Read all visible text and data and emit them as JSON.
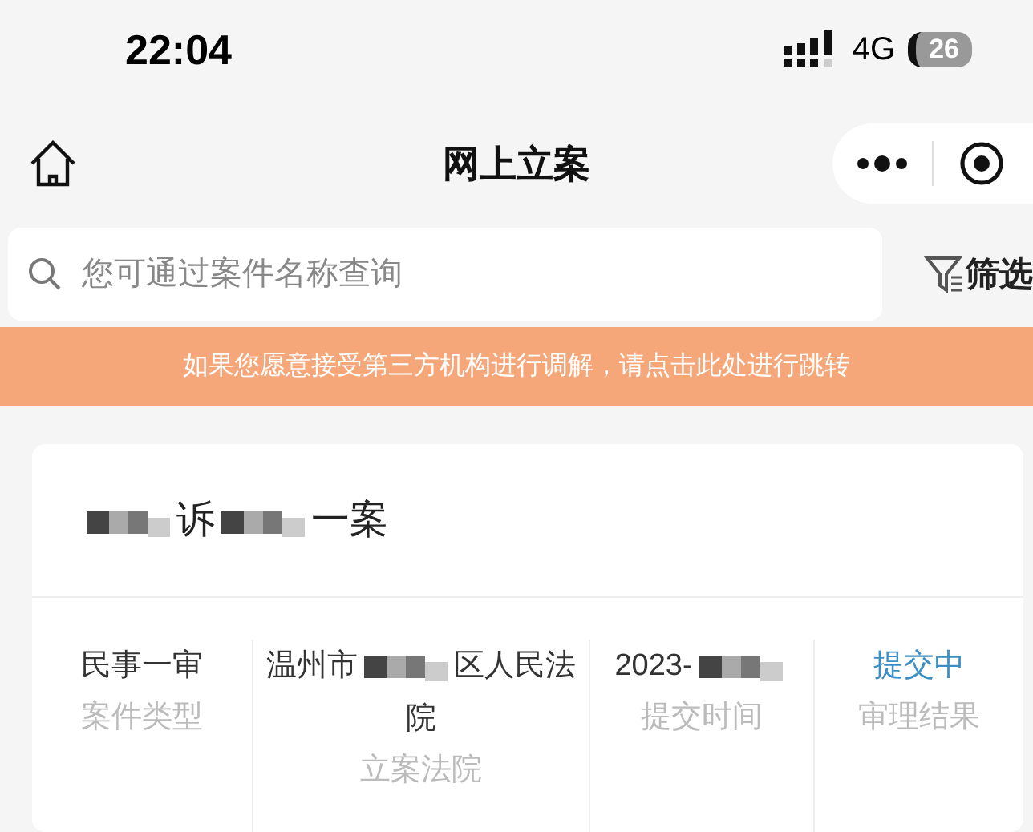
{
  "status_bar": {
    "time": "22:04",
    "network": "4G",
    "battery": "26"
  },
  "nav_bar": {
    "title": "网上立案"
  },
  "search": {
    "placeholder": "您可通过案件名称查询"
  },
  "filter": {
    "label": "筛选"
  },
  "banner": {
    "text": "如果您愿意接受第三方机构进行调解，请点击此处进行跳转"
  },
  "case_card": {
    "title": [
      {
        "kind": "redaction"
      },
      {
        "kind": "text",
        "text": "诉"
      },
      {
        "kind": "redaction"
      },
      {
        "kind": "text",
        "text": "一案"
      }
    ],
    "fields": [
      {
        "value": [
          {
            "kind": "text",
            "text": "民事一审"
          }
        ],
        "label": "案件类型",
        "status": false
      },
      {
        "value": [
          {
            "kind": "text",
            "text": "温州市"
          },
          {
            "kind": "redaction"
          },
          {
            "kind": "text",
            "text": "区人民法院"
          }
        ],
        "label": "立案法院",
        "status": false
      },
      {
        "value": [
          {
            "kind": "text",
            "text": "2023-"
          },
          {
            "kind": "redaction"
          }
        ],
        "label": "提交时间",
        "status": false
      },
      {
        "value": [
          {
            "kind": "text",
            "text": "提交中"
          }
        ],
        "label": "审理结果",
        "status": true
      }
    ]
  }
}
